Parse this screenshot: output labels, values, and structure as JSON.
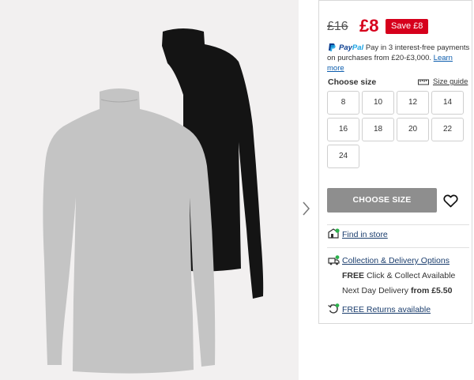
{
  "pricing": {
    "old_price": "£16",
    "new_price": "£8",
    "save_badge": "Save £8"
  },
  "paypal": {
    "brand_pay": "Pay",
    "brand_pal": "Pal",
    "message": "Pay in 3 interest-free payments on purchases from £20-£3,000.",
    "learn_more": "Learn more"
  },
  "sizes": {
    "label": "Choose size",
    "guide_label": "Size guide",
    "options": [
      "8",
      "10",
      "12",
      "14",
      "16",
      "18",
      "20",
      "22",
      "24"
    ]
  },
  "actions": {
    "choose_size_button": "CHOOSE SIZE"
  },
  "store": {
    "find_in_store": "Find in store"
  },
  "delivery": {
    "options_link": "Collection & Delivery Options",
    "click_collect_free": "FREE",
    "click_collect_text": "Click & Collect Available",
    "next_day_text": "Next Day Delivery",
    "next_day_from": "from £5.50",
    "returns_link": "FREE Returns available"
  },
  "colors": {
    "sale_red": "#d6001c",
    "link_blue": "#1a3d6d",
    "button_grey": "#8e8e8e",
    "status_green": "#2bb24c"
  }
}
